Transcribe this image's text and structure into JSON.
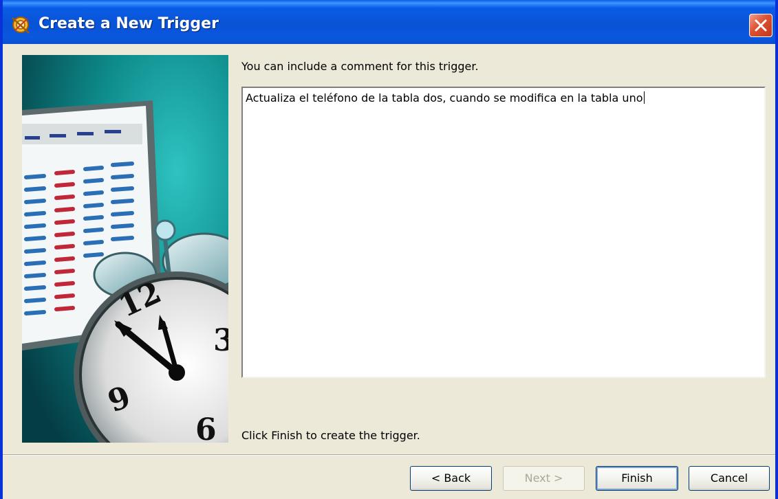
{
  "window": {
    "title": "Create a New Trigger",
    "close_icon": "close-icon",
    "app_icon": "trigger-wizard-icon"
  },
  "main": {
    "prompt_label": "You can include a comment for this trigger.",
    "comment_value": "Actualiza el teléfono de la tabla dos, cuando se modifica en la tabla uno",
    "finish_hint": "Click Finish to create the trigger."
  },
  "buttons": {
    "back": "< Back",
    "next": "Next >",
    "finish": "Finish",
    "cancel": "Cancel"
  },
  "illustration": {
    "icon": "alarm-clock-calendar-illustration",
    "clock_numbers": [
      "12",
      "3",
      "9",
      "6"
    ]
  },
  "colors": {
    "titlebar": "#0853d6",
    "dialog_bg": "#ece9d8",
    "art_teal": "#0e7f80",
    "close_red": "#dd5030"
  }
}
